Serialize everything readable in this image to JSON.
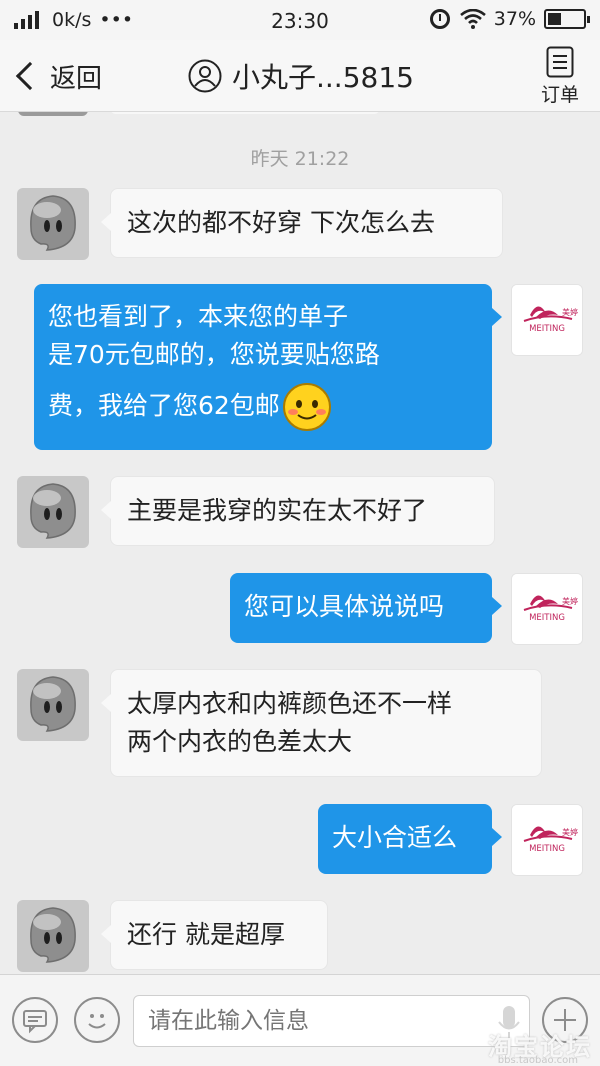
{
  "status_bar": {
    "network_speed": "0k/s",
    "more": "•••",
    "time": "23:30",
    "battery_percent": "37%",
    "battery_level": 0.37
  },
  "nav": {
    "back_label": "返回",
    "title": "小丸子...5815",
    "order_label": "订单"
  },
  "chat": {
    "timestamp": "昨天 21:22",
    "messages": [
      {
        "side": "peer",
        "text": "这次的都不好穿 下次怎么去"
      },
      {
        "side": "self",
        "lines": [
          "您也看到了，本来您的单子",
          "是70元包邮的，您说要贴您路",
          "费，我给了您62包邮"
        ],
        "has_emoji": true
      },
      {
        "side": "peer",
        "text": "主要是我穿的实在太不好了"
      },
      {
        "side": "self",
        "text": "您可以具体说说吗"
      },
      {
        "side": "peer",
        "lines": [
          "太厚内衣和内裤颜色还不一样",
          "两个内衣的色差太大"
        ]
      },
      {
        "side": "self",
        "text": "大小合适么"
      },
      {
        "side": "peer",
        "text": "还行 就是超厚"
      }
    ]
  },
  "self_avatar": {
    "logo_text": "MEITING",
    "logo_cn": "美婷",
    "brand_color": "#c0245c"
  },
  "input": {
    "placeholder": "请在此输入信息"
  },
  "watermark": {
    "text": "淘宝论坛",
    "sub": "bbs.taobao.com"
  },
  "colors": {
    "bubble_out": "#1f95e8",
    "bubble_in": "#f8f8f8",
    "background": "#ededed"
  }
}
